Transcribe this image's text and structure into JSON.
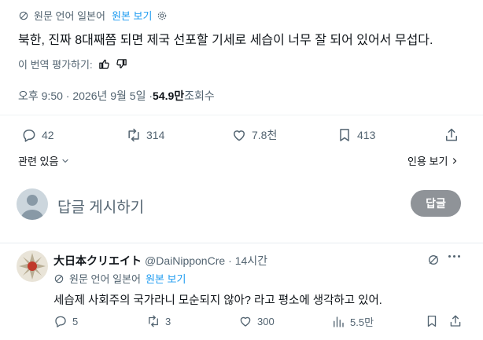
{
  "top_bar": {
    "translated_from": "원문 언어 일본어",
    "view_original": "원본 보기"
  },
  "tweet": {
    "text": "북한, 진짜 8대째쯤 되면 제국 선포할 기세로 세습이 너무 잘 되어 있어서 무섭다.",
    "rate_translation": "이 번역 평가하기:",
    "timestamp": "오후 9:50 · 2026년 9월 5일 · ",
    "views_count": "54.9만",
    "views_label": " 조회수",
    "replies": "42",
    "retweets": "314",
    "likes": "7.8천",
    "bookmarks": "413"
  },
  "related": {
    "label": "관련 있음",
    "quotes_label": "인용 보기"
  },
  "reply_composer": {
    "placeholder": "답글 게시하기",
    "button": "답글"
  },
  "reply": {
    "display_name": "大日本クリエイト",
    "handle": "@DaiNipponCre",
    "time": "· 14시간",
    "translated_from": "원문 언어 일본어",
    "view_original": "원본 보기",
    "text": "세습제 사회주의 국가라니 모순되지 않아? 라고 평소에 생각하고 있어.",
    "replies": "5",
    "retweets": "3",
    "likes": "300",
    "views": "5.5만"
  },
  "colors": {
    "accent": "#1d9bf0",
    "muted": "#536471",
    "text": "#0f1419",
    "divider": "#eff3f4"
  }
}
